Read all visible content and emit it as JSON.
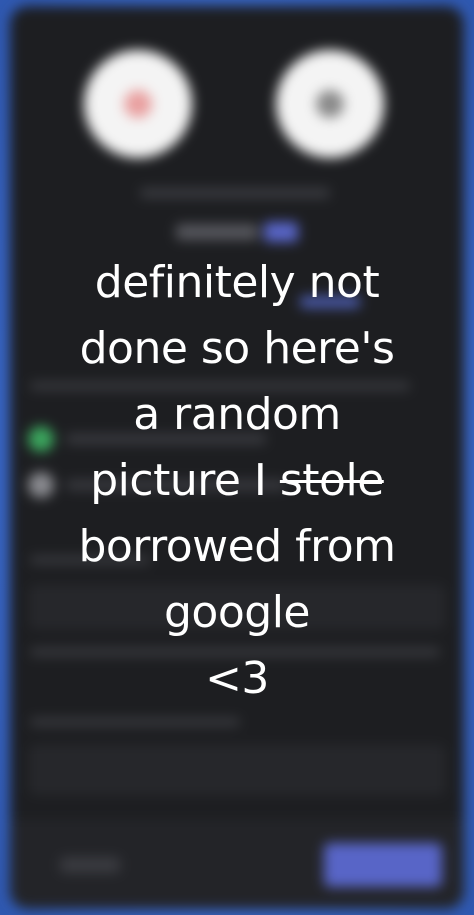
{
  "caption": {
    "line1": "definitely not",
    "line2": "done so here's",
    "line3": "a random",
    "line4_prefix": "picture I ",
    "line4_struck": "stole",
    "line5": "borrowed from",
    "line6": "google",
    "line7": "<3"
  },
  "colors": {
    "background_blue": "#3f6fd0",
    "app_dark": "#1d1e21",
    "accent_primary": "#5865c7",
    "status_green": "#3ba55d"
  }
}
